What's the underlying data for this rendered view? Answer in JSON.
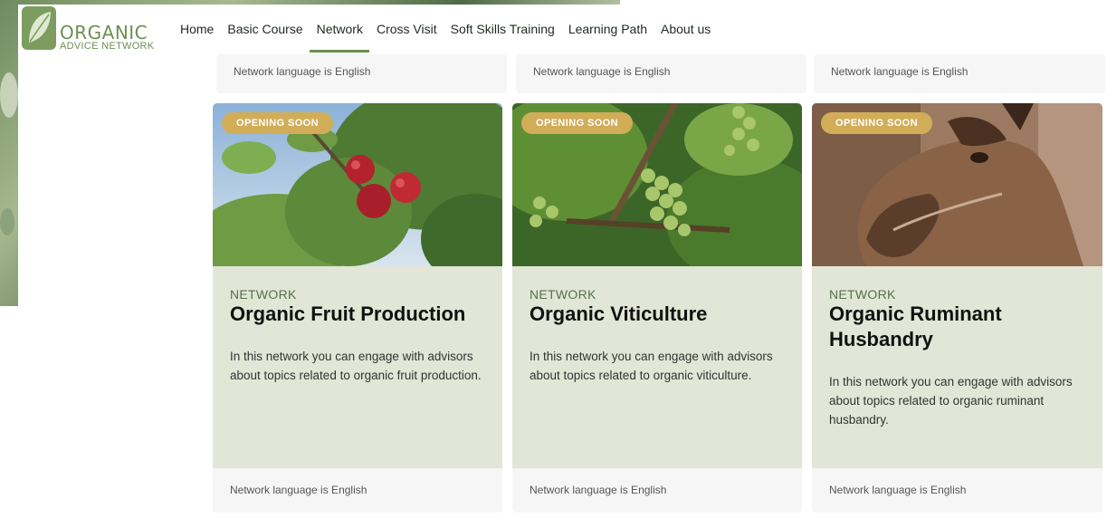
{
  "brand": {
    "name": "ORGANIC",
    "subtitle": "ADVICE NETWORK"
  },
  "nav": {
    "items": [
      {
        "label": "Home",
        "active": false
      },
      {
        "label": "Basic Course",
        "active": false
      },
      {
        "label": "Network",
        "active": true
      },
      {
        "label": "Cross Visit",
        "active": false
      },
      {
        "label": "Soft Skills Training",
        "active": false
      },
      {
        "label": "Learning Path",
        "active": false
      },
      {
        "label": "About us",
        "active": false
      }
    ]
  },
  "top_strip": [
    {
      "language": "Network language is English"
    },
    {
      "language": "Network language is English"
    },
    {
      "language": "Network language is English"
    }
  ],
  "cards": [
    {
      "badge": "OPENING SOON",
      "eyebrow": "NETWORK",
      "title": "Organic Fruit Production",
      "description": "In this network you can engage with advisors about topics related to organic fruit production.",
      "language": "Network language is English",
      "image": "apples-on-tree"
    },
    {
      "badge": "OPENING SOON",
      "eyebrow": "NETWORK",
      "title": "Organic Viticulture",
      "description": "In this network you can engage with advisors about topics related to organic viticulture.",
      "language": "Network language is English",
      "image": "green-grapes-on-vine"
    },
    {
      "badge": "OPENING SOON",
      "eyebrow": "NETWORK",
      "title": "Organic Ruminant Husbandry",
      "description": "In this network you can engage with advisors about topics related to organic ruminant husbandry.",
      "language": "Network language is English",
      "image": "goat-portrait"
    }
  ],
  "colors": {
    "accent": "#6d8f52",
    "badge": "#d1ad58",
    "card_body": "#e2e6d6",
    "card_footer": "#f6f6f6"
  }
}
